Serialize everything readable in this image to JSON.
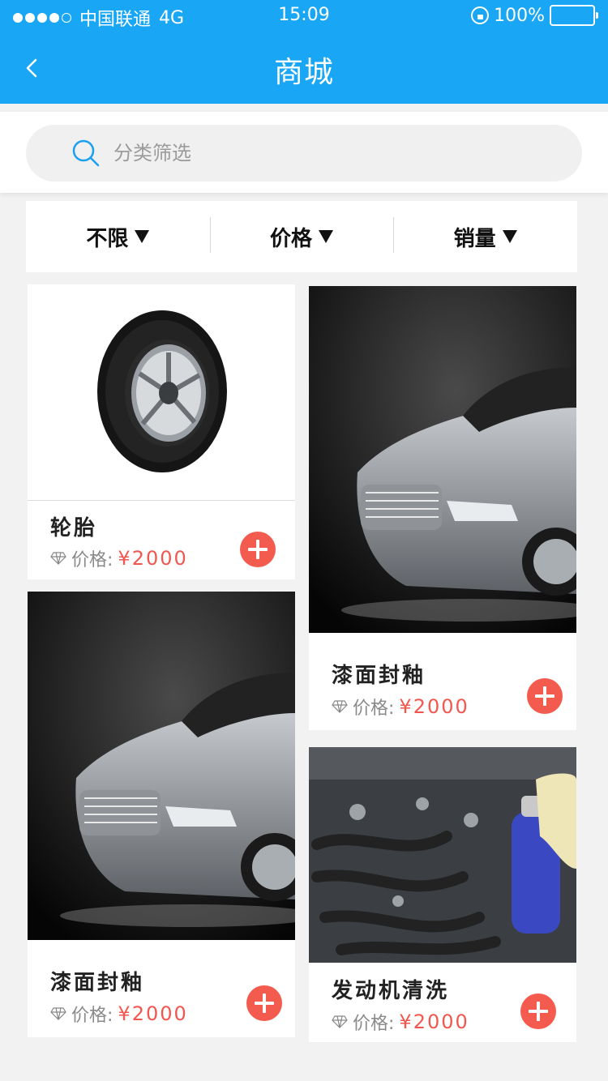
{
  "status_bar": {
    "carrier": "中国联通",
    "network": "4G",
    "time": "15:09",
    "battery": "100%"
  },
  "nav": {
    "title": "商城"
  },
  "search": {
    "placeholder": "分类筛选"
  },
  "filters": [
    {
      "label": "不限"
    },
    {
      "label": "价格"
    },
    {
      "label": "销量"
    }
  ],
  "products": [
    {
      "name": "轮胎",
      "price_label": "价格:",
      "price": "¥2000",
      "image": "tire"
    },
    {
      "name": "漆面封釉",
      "price_label": "价格:",
      "price": "¥2000",
      "image": "car"
    },
    {
      "name": "漆面封釉",
      "price_label": "价格:",
      "price": "¥2000",
      "image": "car"
    },
    {
      "name": "发动机清洗",
      "price_label": "价格:",
      "price": "¥2000",
      "image": "engine"
    }
  ],
  "colors": {
    "header": "#19a6f5",
    "price": "#f2574f",
    "add_button": "#f45b4f"
  }
}
